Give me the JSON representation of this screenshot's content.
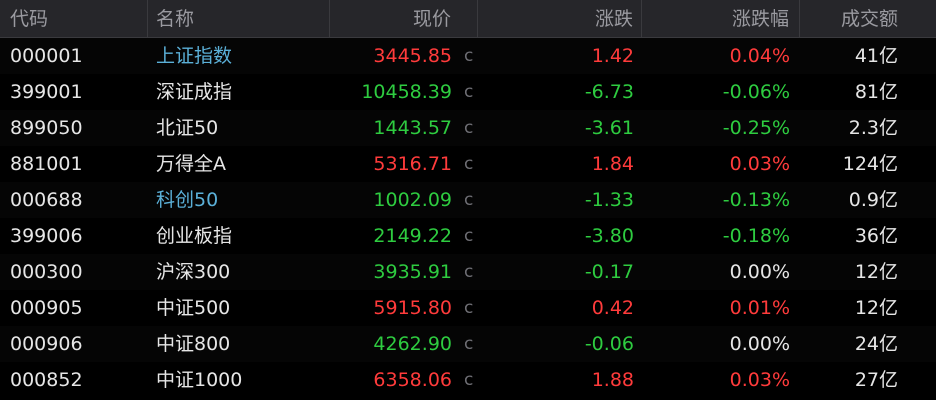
{
  "header": {
    "code": "代码",
    "name": "名称",
    "price": "现价",
    "change": "涨跌",
    "pct": "涨跌幅",
    "volume": "成交额"
  },
  "colors": {
    "up": "#ff3b3b",
    "down": "#2ecc40",
    "flat": "#e6e6e6",
    "link": "#5bb0d8",
    "header_bg": "#26262a"
  },
  "rows": [
    {
      "code": "000001",
      "name": "上证指数",
      "link": true,
      "price": "3445.85",
      "mark": "c",
      "change": "1.42",
      "pct": "0.04%",
      "volume": "41亿",
      "trend": "up"
    },
    {
      "code": "399001",
      "name": "深证成指",
      "link": false,
      "price": "10458.39",
      "mark": "c",
      "change": "-6.73",
      "pct": "-0.06%",
      "volume": "81亿",
      "trend": "down"
    },
    {
      "code": "899050",
      "name": "北证50",
      "link": false,
      "price": "1443.57",
      "mark": "c",
      "change": "-3.61",
      "pct": "-0.25%",
      "volume": "2.3亿",
      "trend": "down"
    },
    {
      "code": "881001",
      "name": "万得全A",
      "link": false,
      "price": "5316.71",
      "mark": "c",
      "change": "1.84",
      "pct": "0.03%",
      "volume": "124亿",
      "trend": "up"
    },
    {
      "code": "000688",
      "name": "科创50",
      "link": true,
      "price": "1002.09",
      "mark": "c",
      "change": "-1.33",
      "pct": "-0.13%",
      "volume": "0.9亿",
      "trend": "down"
    },
    {
      "code": "399006",
      "name": "创业板指",
      "link": false,
      "price": "2149.22",
      "mark": "c",
      "change": "-3.80",
      "pct": "-0.18%",
      "volume": "36亿",
      "trend": "down"
    },
    {
      "code": "000300",
      "name": "沪深300",
      "link": false,
      "price": "3935.91",
      "mark": "c",
      "change": "-0.17",
      "pct": "0.00%",
      "volume": "12亿",
      "trend": "down",
      "pct_trend": "flat"
    },
    {
      "code": "000905",
      "name": "中证500",
      "link": false,
      "price": "5915.80",
      "mark": "c",
      "change": "0.42",
      "pct": "0.01%",
      "volume": "12亿",
      "trend": "up"
    },
    {
      "code": "000906",
      "name": "中证800",
      "link": false,
      "price": "4262.90",
      "mark": "c",
      "change": "-0.06",
      "pct": "0.00%",
      "volume": "24亿",
      "trend": "down",
      "pct_trend": "flat"
    },
    {
      "code": "000852",
      "name": "中证1000",
      "link": false,
      "price": "6358.06",
      "mark": "c",
      "change": "1.88",
      "pct": "0.03%",
      "volume": "27亿",
      "trend": "up"
    }
  ]
}
